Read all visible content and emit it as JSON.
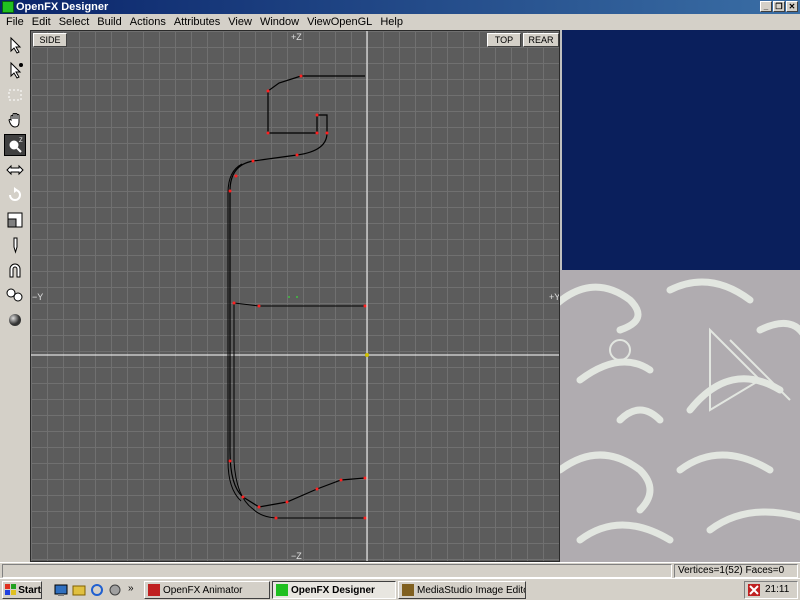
{
  "window": {
    "title": "OpenFX Designer",
    "controls": {
      "minimize": "_",
      "restore": "❐",
      "close": "✕"
    }
  },
  "menu": {
    "items": [
      "File",
      "Edit",
      "Select",
      "Build",
      "Actions",
      "Attributes",
      "View",
      "Window",
      "ViewOpenGL",
      "Help"
    ]
  },
  "toolbar": {
    "tools": [
      {
        "name": "select-arrow-icon",
        "glyph": "↖"
      },
      {
        "name": "select-vertex-icon",
        "glyph": "↖"
      },
      {
        "name": "select-box-icon",
        "glyph": "⬚"
      },
      {
        "name": "pan-hand-icon",
        "glyph": "✋"
      },
      {
        "name": "zoom-icon",
        "glyph": "🔍"
      },
      {
        "name": "move-icon",
        "glyph": "⇔"
      },
      {
        "name": "rotate-icon",
        "glyph": "↻"
      },
      {
        "name": "scale-icon",
        "glyph": "▣"
      },
      {
        "name": "pen-icon",
        "glyph": "✎"
      },
      {
        "name": "magnet-icon",
        "glyph": "∩"
      },
      {
        "name": "spheres-icon",
        "glyph": "●"
      },
      {
        "name": "sphere-icon",
        "glyph": "●"
      }
    ],
    "active_index": 4
  },
  "viewport": {
    "view_label": "SIDE",
    "top_button": "TOP",
    "rear_button": "REAR",
    "axis_top": "+Z",
    "axis_bottom": "−Z",
    "axis_left": "−Y",
    "axis_right": "+Y"
  },
  "statusbar": {
    "info": "Vertices=1(52) Faces=0"
  },
  "taskbar": {
    "start_label": "Start",
    "quick_launch": [
      "desktop-icon",
      "explorer-icon",
      "ie-icon",
      "outlook-icon"
    ],
    "more": "»",
    "tasks": [
      {
        "label": "OpenFX Animator",
        "icon_color": "#c02020",
        "active": false
      },
      {
        "label": "OpenFX Designer",
        "icon_color": "#20c020",
        "active": true
      },
      {
        "label": "MediaStudio Image Editor",
        "icon_color": "#806020",
        "active": false
      }
    ],
    "clock": "21:11"
  },
  "colors": {
    "viewport_bg": "#5c5c5c",
    "preview_bg": "#0a1f5c",
    "vertex": "#ff2020",
    "axis": "#ffffff"
  }
}
